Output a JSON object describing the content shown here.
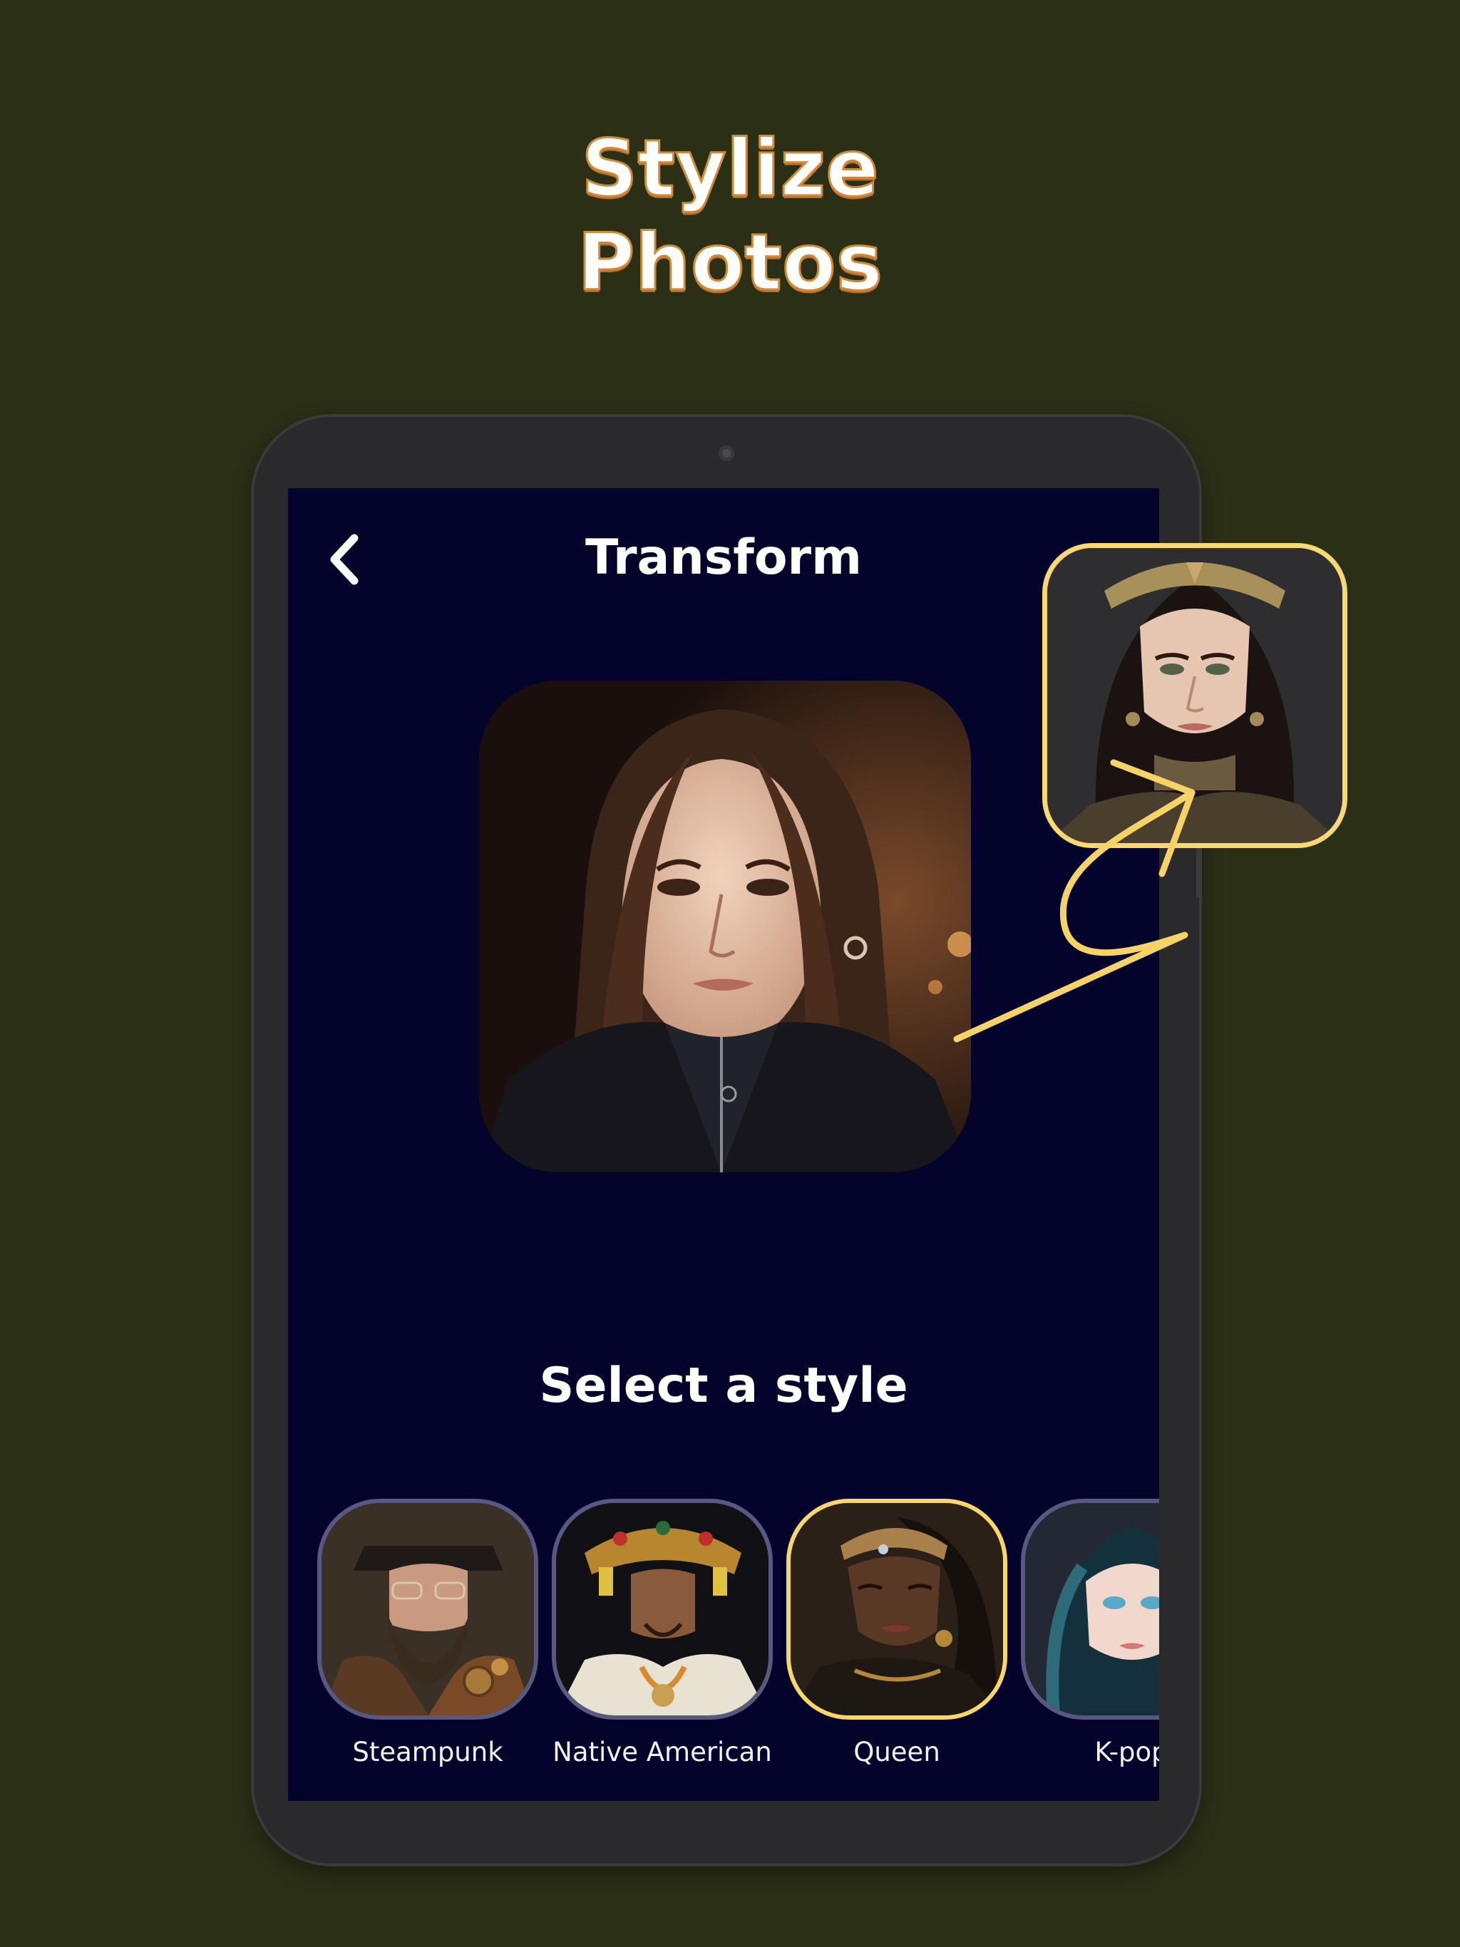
{
  "headline": {
    "line1": "Stylize",
    "line2": "Photos"
  },
  "screen": {
    "title": "Transform",
    "back_icon": "chevron-left-icon",
    "select_title": "Select a style",
    "styles": [
      {
        "label": "Steampunk",
        "selected": false
      },
      {
        "label": "Native American",
        "selected": false
      },
      {
        "label": "Queen",
        "selected": true
      },
      {
        "label": "K-pop",
        "selected": false
      }
    ]
  },
  "colors": {
    "background": "#2b2f16",
    "screen": "#04032c",
    "accent": "#f8d870",
    "headline_outline": "#d08a3a"
  }
}
